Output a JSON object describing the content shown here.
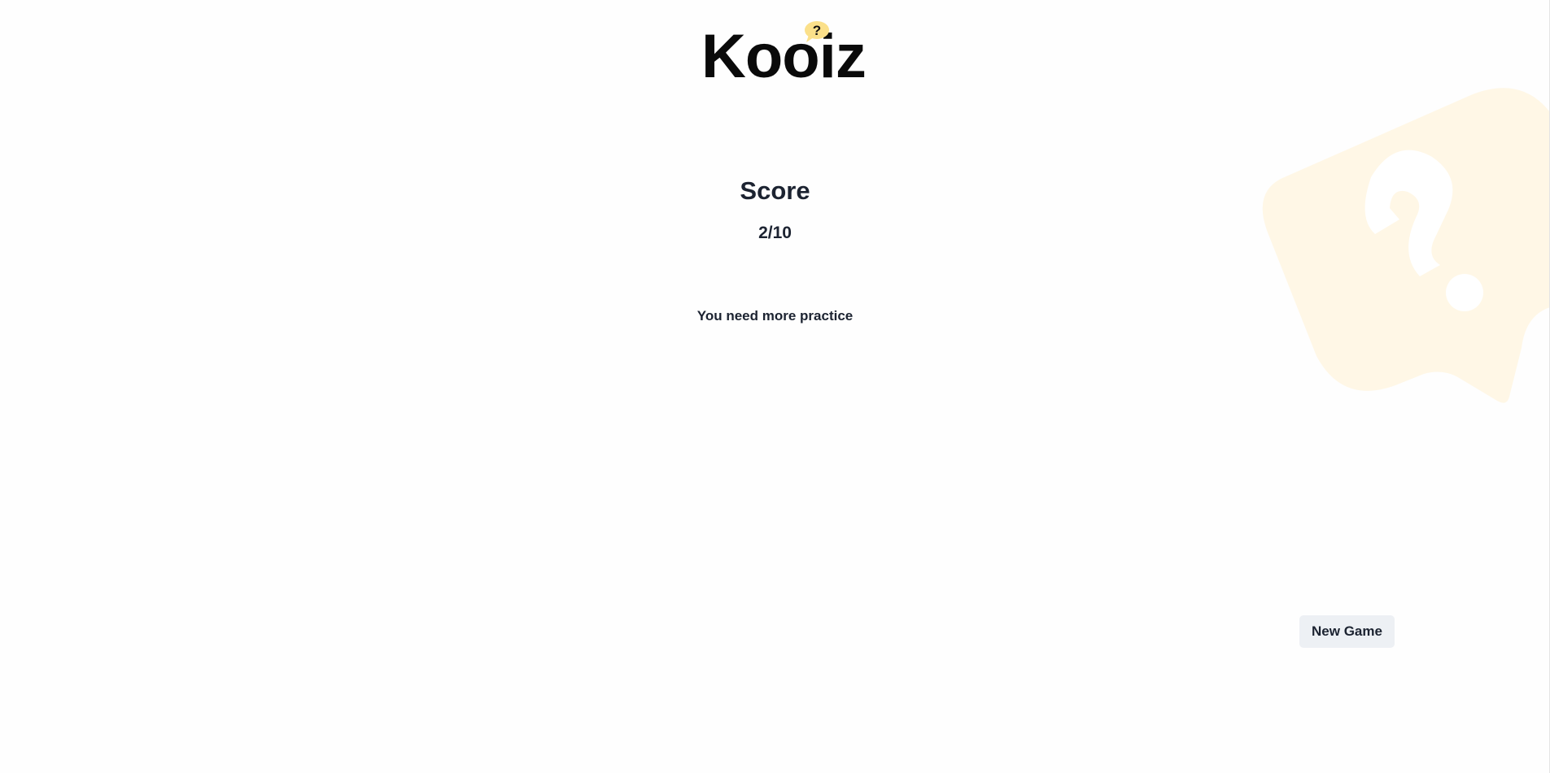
{
  "brand": {
    "name": "Kooiz",
    "badge_glyph": "?",
    "badge_color": "#fbe08a"
  },
  "result": {
    "title": "Score",
    "score": "2/10",
    "message": "You need more practice"
  },
  "actions": {
    "new_game_label": "New Game"
  },
  "colors": {
    "text": "#1c2331",
    "background": "#fefefe",
    "button_bg": "#edf0f4",
    "decor": "#fff7e6"
  },
  "icons": {
    "logo_badge": "question-bubble-icon",
    "background_decor": "question-bubble-icon"
  }
}
